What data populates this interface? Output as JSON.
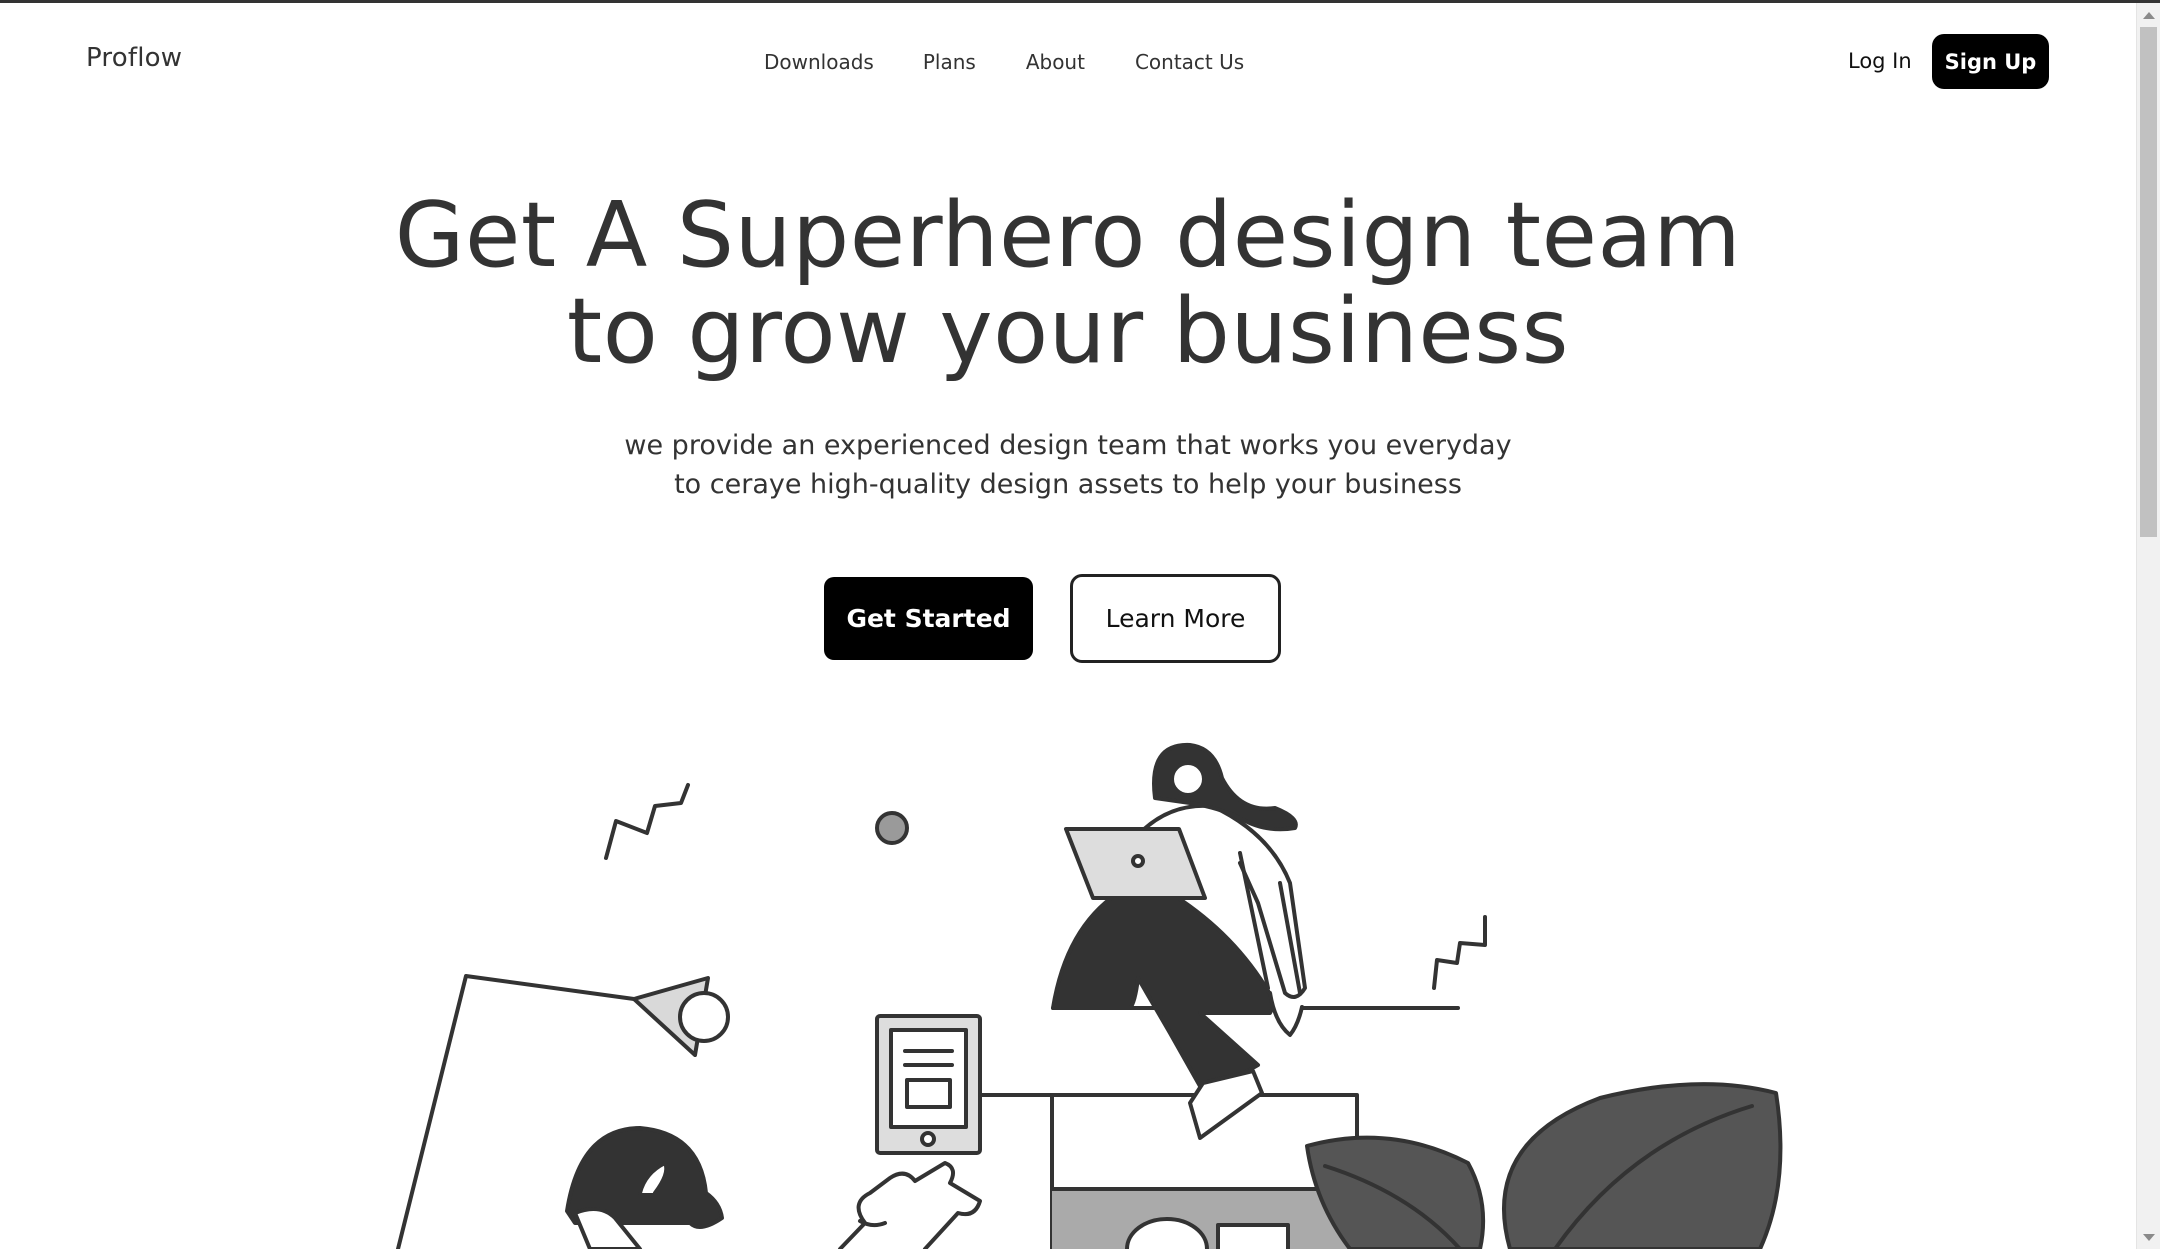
{
  "header": {
    "logo": "Proflow",
    "nav": [
      "Downloads",
      "Plans",
      "About",
      "Contact Us"
    ],
    "login_label": "Log In",
    "signup_label": "Sign Up"
  },
  "hero": {
    "headline_line1": "Get A Superhero design team",
    "headline_line2": "to grow your business",
    "subtext_line1": "we provide an experienced design team that works you everyday",
    "subtext_line2": "to ceraye high-quality design assets to help your business",
    "primary_cta": "Get Started",
    "secondary_cta": "Learn More"
  },
  "colors": {
    "text": "#333333",
    "button_dark": "#000000",
    "illustration_dark": "#333333",
    "illustration_mid": "#555555",
    "illustration_light": "#dddddd"
  },
  "icons": [
    "scroll-up-arrow-icon",
    "scroll-down-arrow-icon"
  ]
}
